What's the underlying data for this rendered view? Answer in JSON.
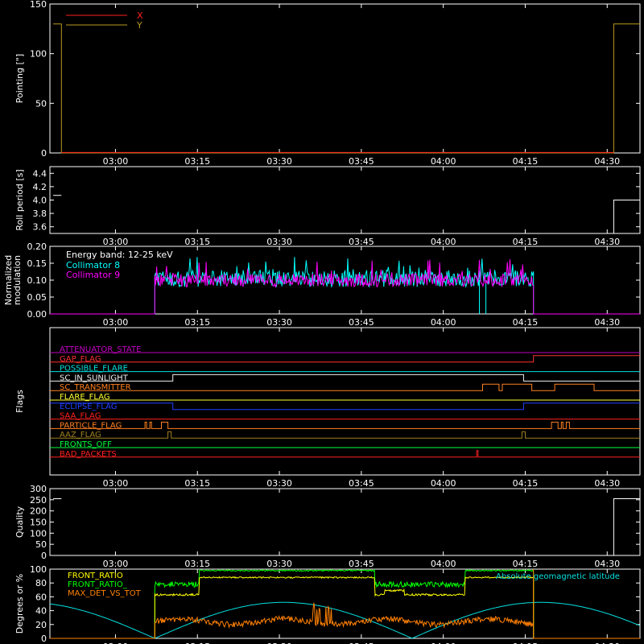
{
  "colors": {
    "background": "#000000",
    "axes": "#ffffff",
    "x_pointing": "#ff2020",
    "y_pointing": "#b89a20",
    "collimator8": "#00ffff",
    "collimator9": "#ff00ff",
    "front_ratio": "#ffff00",
    "front_ratio_2": "#00ff00",
    "max_det": "#ff8000",
    "geomag": "#00e0e0"
  },
  "time_ticks": [
    "03:00",
    "03:15",
    "03:30",
    "03:45",
    "04:00",
    "04:15",
    "04:30"
  ],
  "chart_data": [
    {
      "id": "pointing",
      "type": "line",
      "ylabel": "Pointing [\"]",
      "ylim": [
        0,
        150
      ],
      "yticks": [
        "0",
        "50",
        "100",
        "150"
      ],
      "series": [
        {
          "name": "X",
          "color_key": "x_pointing"
        },
        {
          "name": "Y",
          "color_key": "y_pointing"
        }
      ]
    },
    {
      "id": "roll",
      "type": "line",
      "ylabel": "Roll period [s]",
      "ylim": [
        3.5,
        4.5
      ],
      "yticks": [
        "3.6",
        "3.8",
        "4.0",
        "4.2",
        "4.4"
      ]
    },
    {
      "id": "modulation",
      "type": "line",
      "ylabel": "Normalized modulation",
      "ylabel_lines": [
        "Normalized",
        "modulation"
      ],
      "ylim": [
        0,
        0.2
      ],
      "yticks": [
        "0.00",
        "0.05",
        "0.10",
        "0.15",
        "0.20"
      ],
      "annotation": "Energy band: 12-25 keV",
      "series": [
        {
          "name": "Collimator 8",
          "color_key": "collimator8"
        },
        {
          "name": "Collimator 9",
          "color_key": "collimator9"
        }
      ]
    },
    {
      "id": "flags",
      "type": "line",
      "ylabel": "Flags",
      "series": [
        {
          "name": "ATTENUATOR_STATE",
          "color": "#c000c0"
        },
        {
          "name": "GAP_FLAG",
          "color": "#ff3030"
        },
        {
          "name": "POSSIBLE_FLARE",
          "color": "#00e0e0"
        },
        {
          "name": "SC_IN_SUNLIGHT",
          "color": "#f0f0f0"
        },
        {
          "name": "SC_TRANSMITTER",
          "color": "#ff8020"
        },
        {
          "name": "FLARE_FLAG",
          "color": "#ffff30"
        },
        {
          "name": "ECLIPSE_FLAG",
          "color": "#2040ff"
        },
        {
          "name": "SAA_FLAG",
          "color": "#ff2020"
        },
        {
          "name": "PARTICLE_FLAG",
          "color": "#ff8020"
        },
        {
          "name": "AAZ_FLAG",
          "color": "#a08020"
        },
        {
          "name": "FRONTS_OFF",
          "color": "#00ff40"
        },
        {
          "name": "BAD_PACKETS",
          "color": "#ff2020"
        }
      ]
    },
    {
      "id": "quality",
      "type": "line",
      "ylabel": "Quality",
      "ylim": [
        0,
        300
      ],
      "yticks": [
        "0",
        "50",
        "100",
        "150",
        "200",
        "250",
        "300"
      ]
    },
    {
      "id": "ratios",
      "type": "line",
      "ylabel": "Degrees or %",
      "ylim": [
        0,
        100
      ],
      "yticks": [
        "0",
        "20",
        "40",
        "60",
        "80",
        "100"
      ],
      "series": [
        {
          "name": "FRONT_RATIO",
          "color_key": "front_ratio"
        },
        {
          "name": "FRONT_RATIO_",
          "color_key": "front_ratio_2"
        },
        {
          "name": "MAX_DET_VS_TOT",
          "color_key": "max_det"
        },
        {
          "name": "Absolute geomagnetic latitude",
          "color_key": "geomag"
        }
      ]
    }
  ]
}
